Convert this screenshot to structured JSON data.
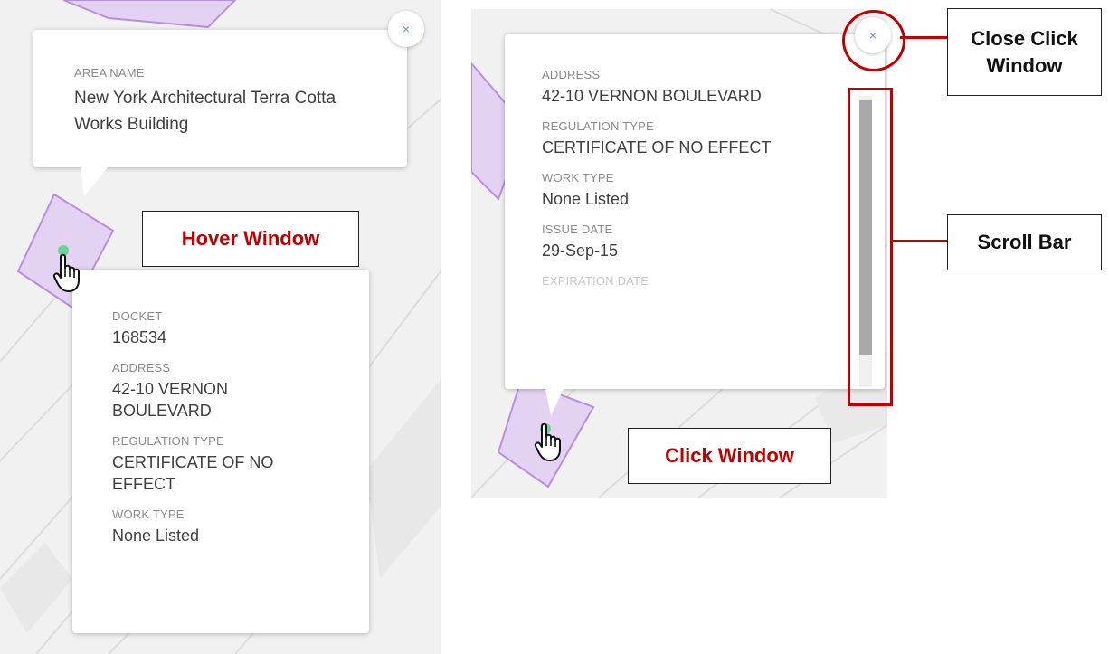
{
  "hover_window": {
    "title_popup": {
      "label": "AREA NAME",
      "value": "New York Architectural Terra Cotta Works Building"
    },
    "detail_popup": {
      "fields": [
        {
          "label": "DOCKET",
          "value": "168534"
        },
        {
          "label": "ADDRESS",
          "value": "42-10 VERNON BOULEVARD"
        },
        {
          "label": "REGULATION TYPE",
          "value": "CERTIFICATE OF NO EFFECT"
        },
        {
          "label": "WORK TYPE",
          "value": "None Listed"
        }
      ]
    },
    "close_symbol": "×"
  },
  "click_window": {
    "fields": [
      {
        "label": "ADDRESS",
        "value": "42-10 VERNON BOULEVARD"
      },
      {
        "label": "REGULATION TYPE",
        "value": "CERTIFICATE OF NO EFFECT"
      },
      {
        "label": "WORK TYPE",
        "value": "None Listed"
      },
      {
        "label": "ISSUE DATE",
        "value": "29-Sep-15"
      },
      {
        "label": "EXPIRATION DATE",
        "value": ""
      }
    ],
    "close_symbol": "×"
  },
  "callouts": {
    "hover_window": "Hover Window",
    "click_window": "Click Window",
    "close_click_window": "Close Click Window",
    "scroll_bar": "Scroll Bar"
  },
  "colors": {
    "annotation_red": "#c00000",
    "parcel_fill": "#e3d2f2",
    "parcel_stroke": "#b98de0",
    "marker_green": "#6cd29a",
    "close_icon_blue": "#5a8fd0"
  },
  "icons": [
    "close-icon",
    "hand-pointer-icon",
    "location-marker-icon"
  ]
}
